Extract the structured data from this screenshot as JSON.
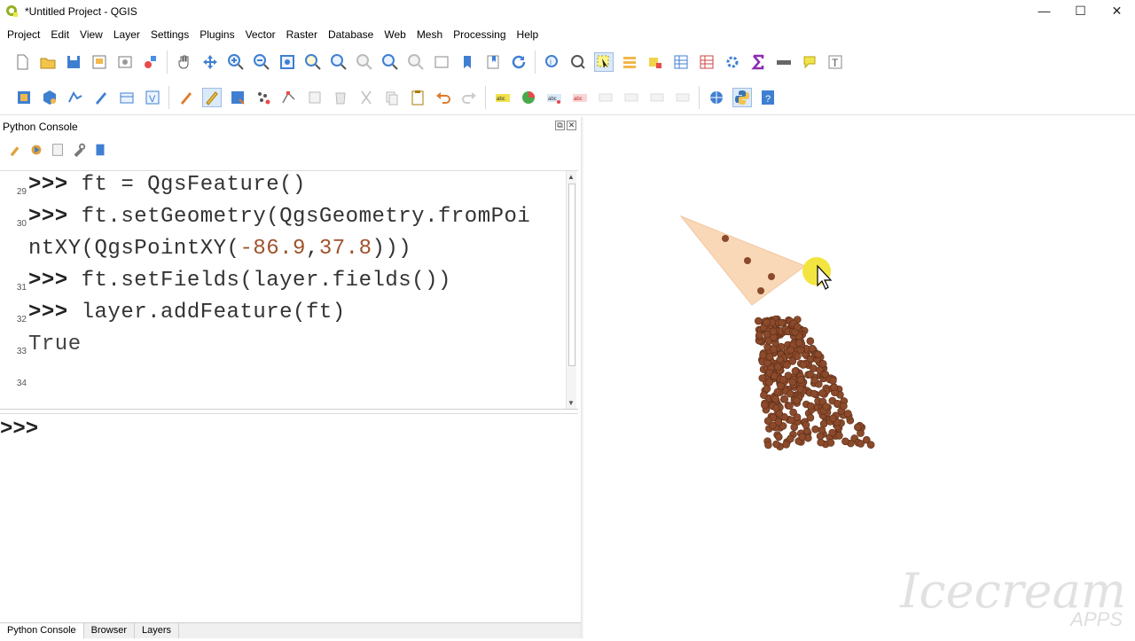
{
  "window": {
    "title": "*Untitled Project - QGIS",
    "controls": [
      "—",
      "☐",
      "✕"
    ]
  },
  "menu": [
    "Project",
    "Edit",
    "View",
    "Layer",
    "Settings",
    "Plugins",
    "Vector",
    "Raster",
    "Database",
    "Web",
    "Mesh",
    "Processing",
    "Help"
  ],
  "panel": {
    "title": "Python Console",
    "float_btn": "⧉",
    "close_btn": "✕"
  },
  "console": {
    "lines": [
      {
        "num": "29",
        "prompt": ">>>",
        "code": " ft = QgsFeature()"
      },
      {
        "num": "30",
        "prompt": ">>>",
        "code": " ft.setGeometry(QgsGeometry.fromPoi"
      },
      {
        "num": "",
        "prompt": "",
        "code_a": "ntXY(QgsPointXY(",
        "num_a": "-86.9",
        "comma": ",",
        "num_b": "37.8",
        "code_b": ")))"
      },
      {
        "num": "31",
        "prompt": ">>>",
        "code": " ft.setFields(layer.fields())"
      },
      {
        "num": "32",
        "prompt": ">>>",
        "code": " layer.addFeature(ft)"
      },
      {
        "num": "33",
        "prompt": "",
        "code": "True"
      },
      {
        "num": "34",
        "prompt": "",
        "code": ""
      }
    ],
    "input_prompt": ">>>"
  },
  "tabs": [
    "Python Console",
    "Browser",
    "Layers"
  ],
  "map": {
    "points_color": "#8b4a2b",
    "triangle_color": "#f9d8b8",
    "highlight_color": "#f2e22a"
  },
  "watermark": {
    "main": "Icecream",
    "sub": "APPS"
  }
}
